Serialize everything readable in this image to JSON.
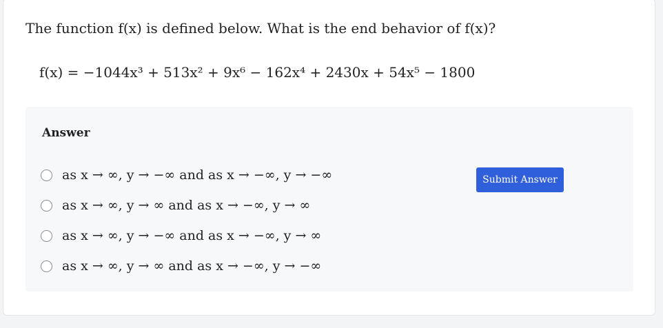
{
  "question": {
    "text": "The function f(x) is defined below. What is the end behavior of f(x)?",
    "formula": "f(x) = −1044x³ + 513x² + 9x⁶ − 162x⁴ + 2430x + 54x⁵ − 1800"
  },
  "answer": {
    "heading": "Answer",
    "options": [
      "as x → ∞, y → −∞ and as x → −∞, y → −∞",
      "as x → ∞, y → ∞ and as x → −∞, y → ∞",
      "as x → ∞, y → −∞ and as x → −∞, y → ∞",
      "as x → ∞, y → ∞ and as x → −∞, y → −∞"
    ],
    "submit_label": "Submit Answer"
  },
  "colors": {
    "submit_bg": "#2f5fdb",
    "panel_bg": "#f7f8fa"
  }
}
